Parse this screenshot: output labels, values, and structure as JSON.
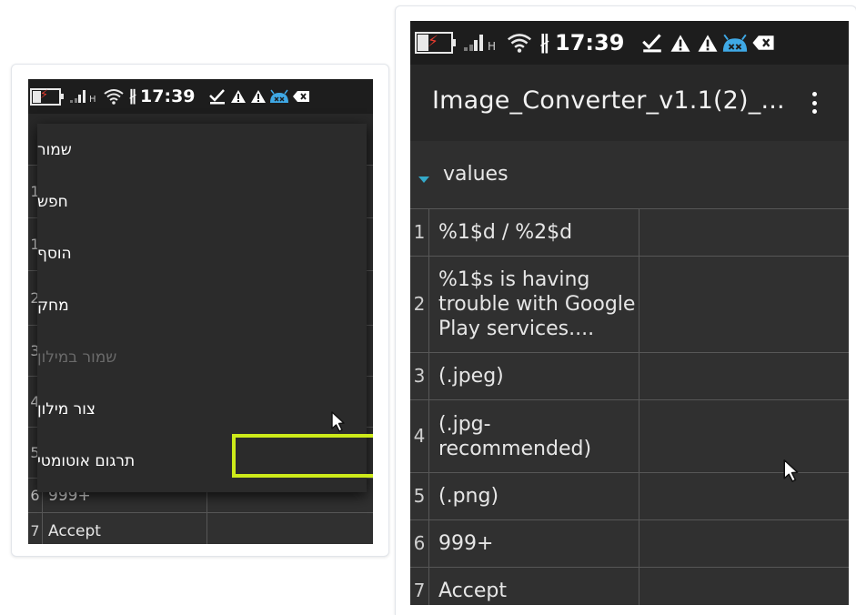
{
  "status_bar": {
    "time": "17:39",
    "network_type": "H",
    "icons": [
      "battery-charging-icon",
      "signal-icon",
      "wifi-icon",
      "bluetooth-icon",
      "checkmark-icon",
      "warning-icon",
      "warning-icon",
      "android-debug-icon",
      "tag-icon"
    ]
  },
  "app_bar": {
    "title": "Image_Converter_v1.1(2)_...",
    "overflow_icon": "more-vert-icon"
  },
  "group": {
    "label": "values",
    "icon": "expand-triangle-icon"
  },
  "rows": [
    {
      "index": "1",
      "key": "%1$d / %2$d",
      "value": ""
    },
    {
      "index": "2",
      "key": "%1$s is having trouble with Google Play services....",
      "value": ""
    },
    {
      "index": "3",
      "key": "(.jpeg)",
      "value": ""
    },
    {
      "index": "4",
      "key": "(.jpg-recommended)",
      "value": ""
    },
    {
      "index": "5",
      "key": "(.png)",
      "value": ""
    },
    {
      "index": "6",
      "key": "999+",
      "value": ""
    },
    {
      "index": "7",
      "key": "Accept",
      "value": ""
    }
  ],
  "menu": {
    "items": [
      {
        "label": "שמור",
        "enabled": true
      },
      {
        "label": "חפש",
        "enabled": true
      },
      {
        "label": "הוסף",
        "enabled": true
      },
      {
        "label": "מחק",
        "enabled": true
      },
      {
        "label": "שמור במילון",
        "enabled": false
      },
      {
        "label": "צור מילון",
        "enabled": true
      },
      {
        "label": "תרגום אוטומטי",
        "enabled": true,
        "highlighted": true
      }
    ]
  },
  "colors": {
    "background": "#303030",
    "status_bar": "#1d1d1d",
    "action_bar": "#282828",
    "accent": "#34a9c9",
    "highlight": "#cdea1a",
    "android_icon": "#3fa9e6"
  }
}
